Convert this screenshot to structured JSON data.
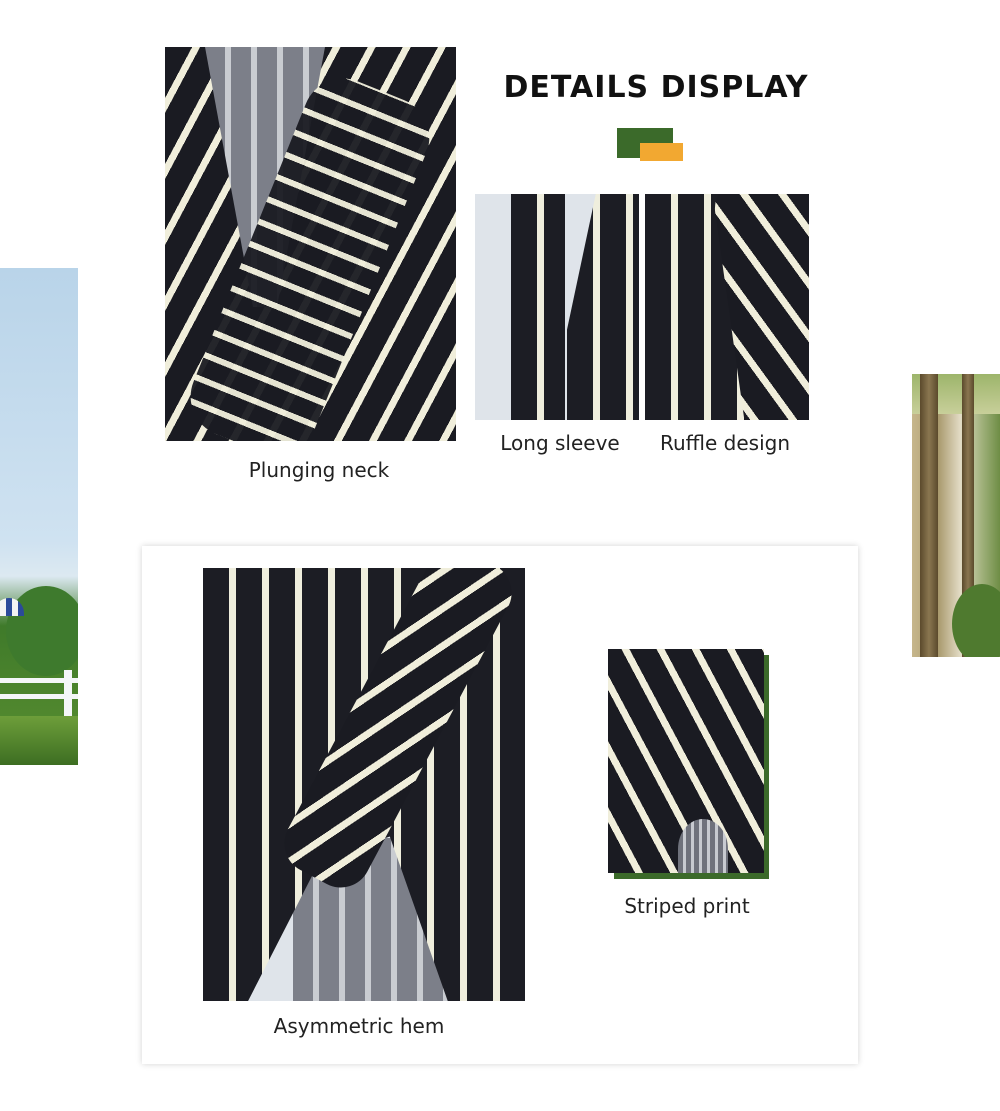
{
  "heading": "DETAILS DISPLAY",
  "colors": {
    "accent_green": "#3b6a2a",
    "accent_orange": "#f2a831"
  },
  "details": {
    "plunging_neck": "Plunging neck",
    "long_sleeve": "Long sleeve",
    "ruffle_design": "Ruffle design",
    "asymmetric_hem": "Asymmetric hem",
    "striped_print": "Striped print"
  }
}
